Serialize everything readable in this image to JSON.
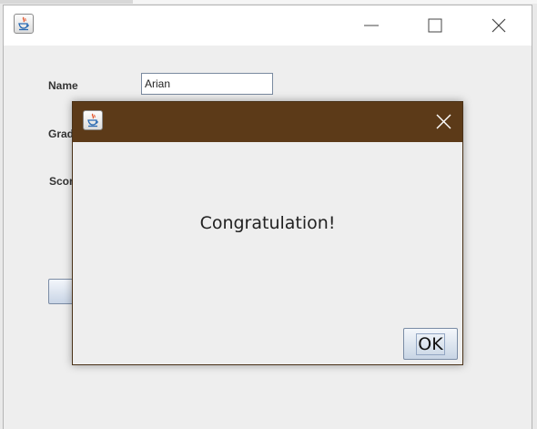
{
  "main_window": {
    "title": "",
    "icon": "java-icon",
    "controls": {
      "minimize_icon": "minimize-icon",
      "maximize_icon": "maximize-icon",
      "close_icon": "close-icon"
    },
    "form": {
      "name_label": "Name",
      "name_value": "Arian",
      "grade_label": "Grad",
      "score_label": "Scor"
    }
  },
  "dialog": {
    "icon": "java-icon",
    "close_icon": "close-icon",
    "message": "Congratulation!",
    "ok_label": "OK",
    "titlebar_color": "#5c3a18"
  }
}
